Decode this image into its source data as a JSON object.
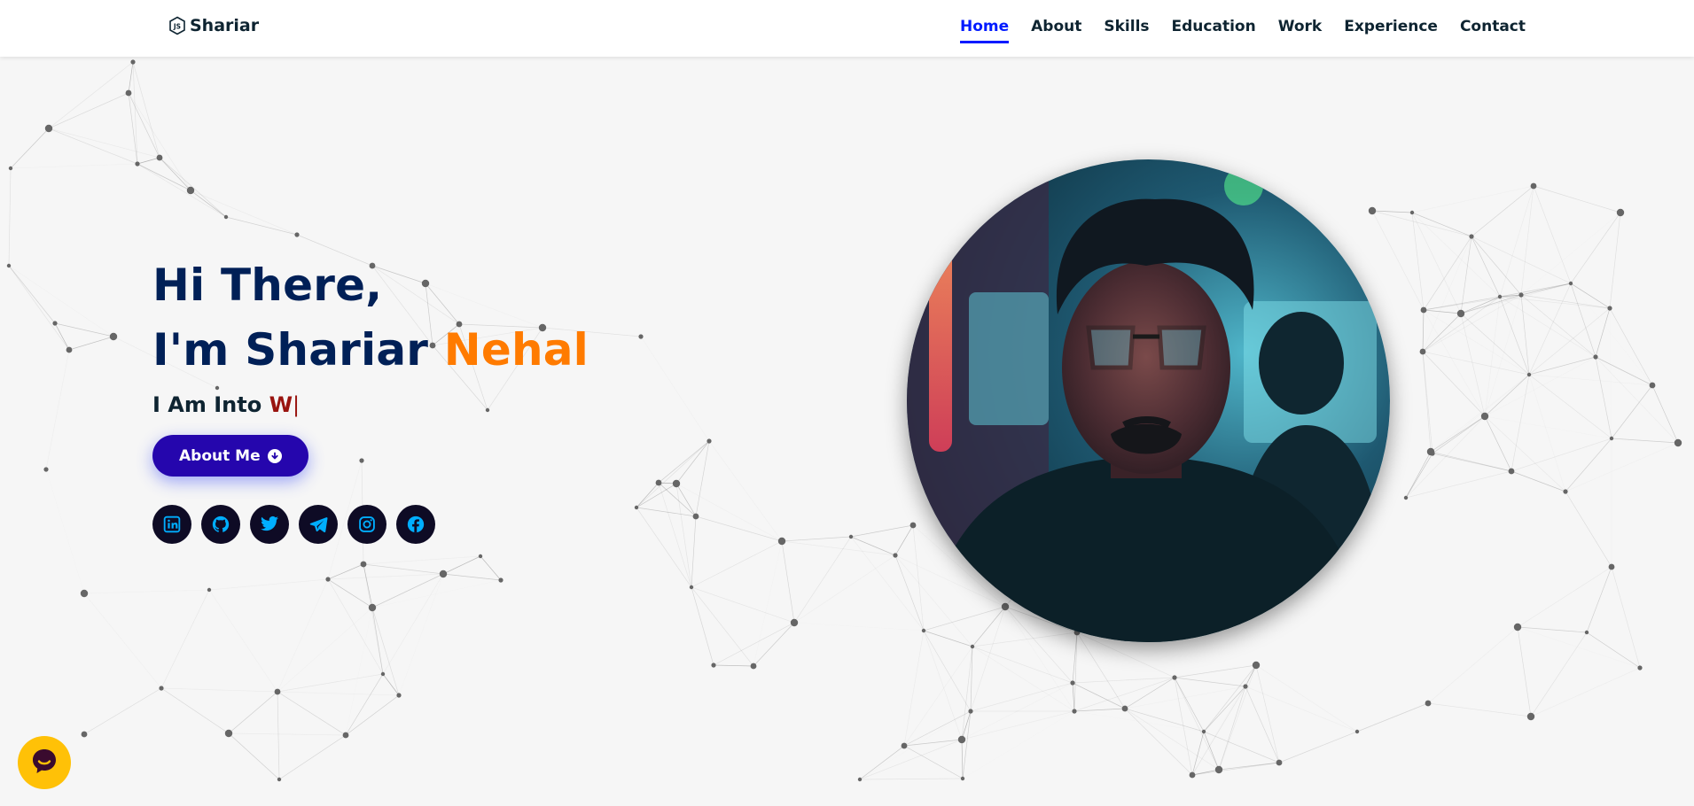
{
  "brand": {
    "logo_text": "Shariar"
  },
  "nav": {
    "items": [
      {
        "label": "Home",
        "active": true
      },
      {
        "label": "About"
      },
      {
        "label": "Skills"
      },
      {
        "label": "Education"
      },
      {
        "label": "Work"
      },
      {
        "label": "Experience"
      },
      {
        "label": "Contact"
      }
    ]
  },
  "hero": {
    "greeting_line1": "Hi There,",
    "greeting_line2_prefix": "I'm Shariar ",
    "greeting_line2_accent": "Nehal",
    "typing_prefix": "I Am Into ",
    "typing_text": "W",
    "typing_cursor": "|",
    "button_label": "About Me"
  },
  "social": [
    {
      "icon": "linkedin-icon"
    },
    {
      "icon": "github-icon"
    },
    {
      "icon": "twitter-icon"
    },
    {
      "icon": "telegram-icon"
    },
    {
      "icon": "instagram-icon"
    },
    {
      "icon": "facebook-icon"
    }
  ],
  "colors": {
    "nav_active": "#011aff",
    "heading": "#002057",
    "accent_orange": "#ff7b00",
    "typing_red": "#99140f",
    "button": "#2506ad",
    "social_icon": "#00aeff",
    "chat_bubble": "#ffc107"
  }
}
